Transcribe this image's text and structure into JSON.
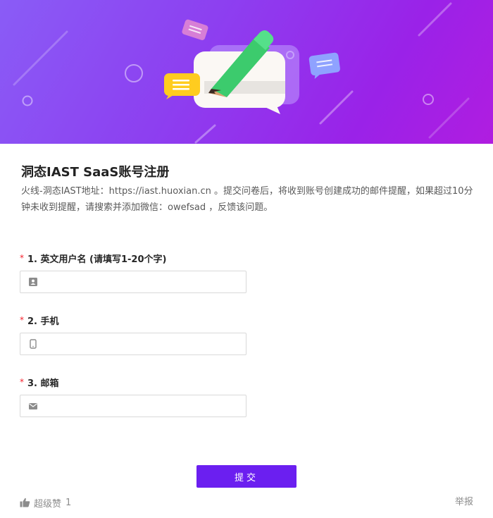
{
  "form": {
    "title": "洞态IAST SaaS账号注册",
    "description": "火线-洞态IAST地址：https://iast.huoxian.cn 。提交问卷后，将收到账号创建成功的邮件提醒，如果超过10分钟未收到提醒，请搜索并添加微信：owefsad ，反馈该问题。"
  },
  "questions": [
    {
      "required_mark": "*",
      "label": "1. 英文用户名 (请填写1-20个字)",
      "icon": "user-card-icon",
      "value": "",
      "placeholder": ""
    },
    {
      "required_mark": "*",
      "label": "2. 手机",
      "icon": "mobile-phone-icon",
      "value": "",
      "placeholder": ""
    },
    {
      "required_mark": "*",
      "label": "3. 邮箱",
      "icon": "envelope-icon",
      "value": "",
      "placeholder": ""
    }
  ],
  "submit": {
    "label": "提交"
  },
  "footer": {
    "like_label": "超级赞",
    "like_count": "1",
    "like_icon": "thumbs-up-icon",
    "report_label": "举报"
  },
  "colors": {
    "accent": "#6b1ff0",
    "banner_start": "#8a5cf6",
    "banner_end": "#b01de0",
    "required": "#f5222d"
  }
}
